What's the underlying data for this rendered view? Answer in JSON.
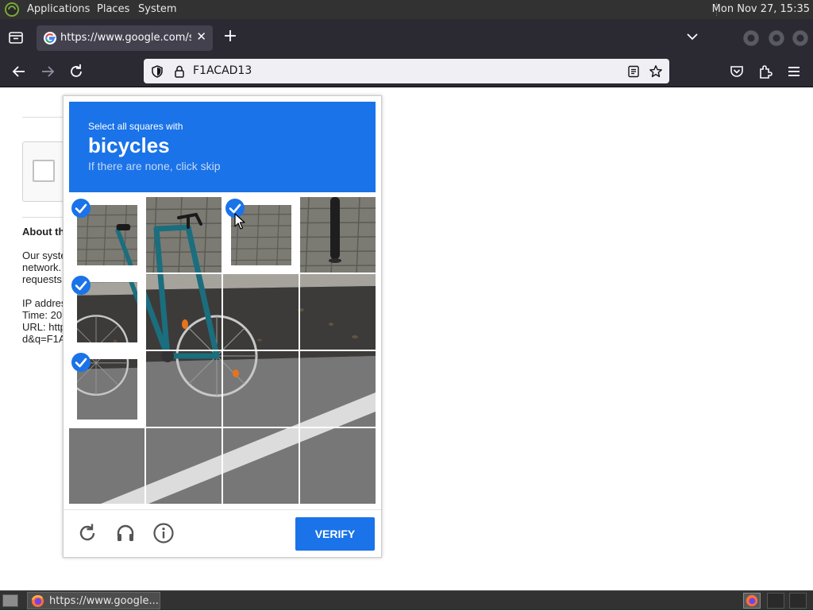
{
  "top_panel": {
    "menus": [
      "Applications",
      "Places",
      "System"
    ],
    "clock": "Mon Nov 27, 15:35"
  },
  "browser": {
    "tab": {
      "title": "https://www.google.com/se",
      "close": "✕"
    },
    "new_tab": "+",
    "url": "F1ACAD13"
  },
  "page": {
    "about_heading": "About th",
    "para1": [
      "Our syste",
      "network.",
      "requests"
    ],
    "para2": [
      "IP addres",
      "Time: 20",
      "URL: http",
      "d&q=F1A"
    ]
  },
  "captcha": {
    "instruction": "Select all squares with",
    "keyword": "bicycles",
    "hint": "If there are none, click skip",
    "verify_label": "VERIFY",
    "selected_tiles": [
      0,
      2,
      4,
      8
    ],
    "accent": "#1a73e8"
  },
  "taskbar": {
    "task_label": "https://www.google..."
  }
}
